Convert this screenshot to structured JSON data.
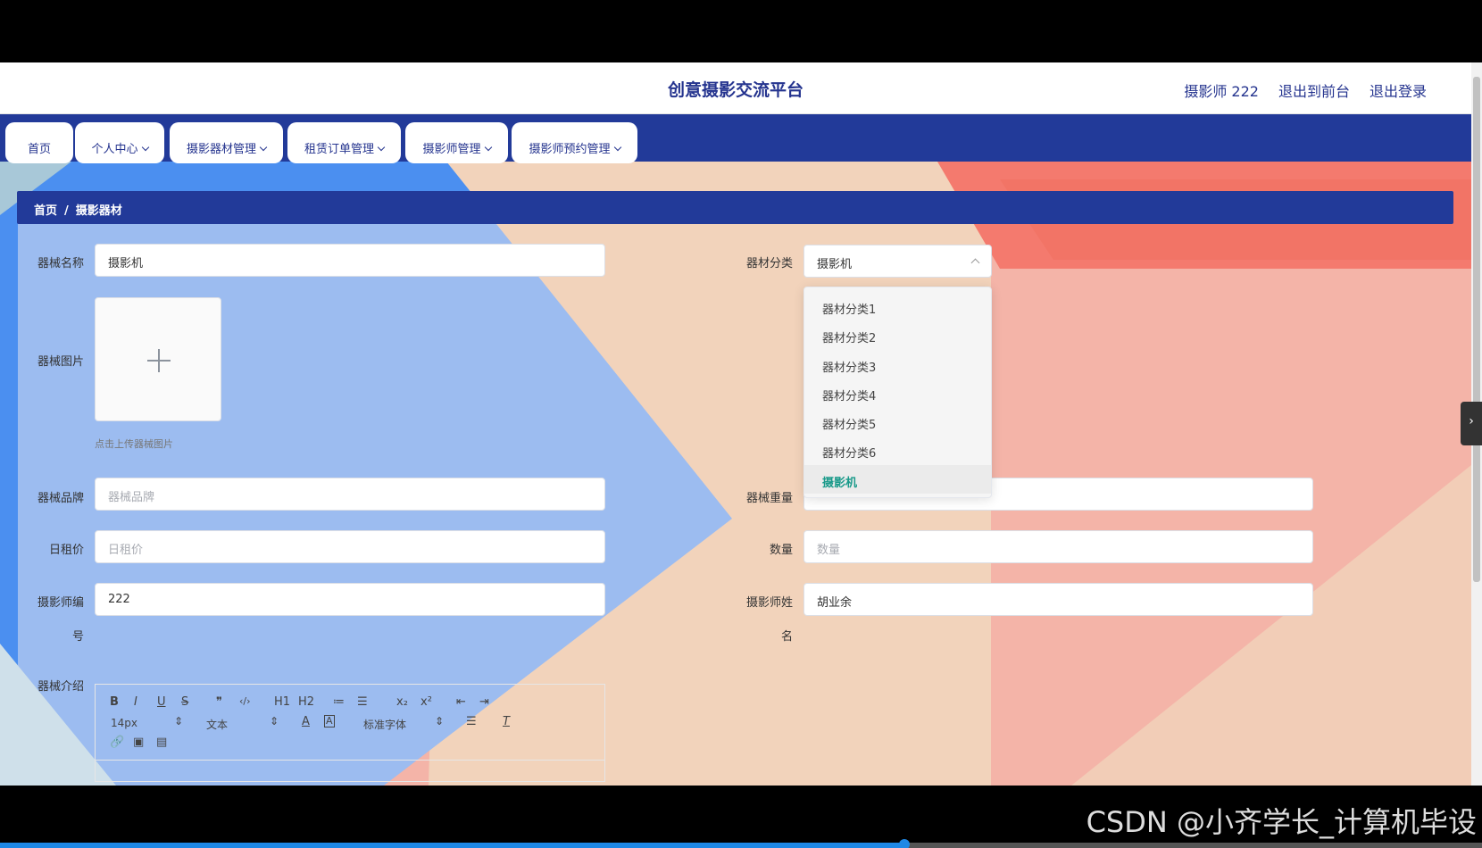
{
  "header": {
    "site_title": "创意摄影交流平台",
    "user": "摄影师 222",
    "exit_front": "退出到前台",
    "logout": "退出登录"
  },
  "nav": [
    {
      "label": "首页",
      "has_dropdown": false
    },
    {
      "label": "个人中心",
      "has_dropdown": true
    },
    {
      "label": "摄影器材管理",
      "has_dropdown": true
    },
    {
      "label": "租赁订单管理",
      "has_dropdown": true
    },
    {
      "label": "摄影师管理",
      "has_dropdown": true
    },
    {
      "label": "摄影师预约管理",
      "has_dropdown": true
    }
  ],
  "breadcrumb": {
    "home": "首页",
    "separator": "/",
    "current": "摄影器材"
  },
  "form": {
    "name_label": "器械名称",
    "name_value": "摄影机",
    "category_label": "器材分类",
    "category_value": "摄影机",
    "image_label": "器械图片",
    "upload_tip": "点击上传器械图片",
    "brand_label": "器械品牌",
    "brand_placeholder": "器械品牌",
    "weight_label": "器械重量",
    "price_label": "日租价",
    "price_placeholder": "日租价",
    "qty_label": "数量",
    "qty_placeholder": "数量",
    "pid_label_1": "摄影师编",
    "pid_label_2": "号",
    "pid_value": "222",
    "pname_label_1": "摄影师姓",
    "pname_label_2": "名",
    "pname_value": "胡业余",
    "intro_label": "器械介绍"
  },
  "dropdown": {
    "options": [
      "器材分类1",
      "器材分类2",
      "器材分类3",
      "器材分类4",
      "器材分类5",
      "器材分类6",
      "摄影机"
    ],
    "selected": "摄影机"
  },
  "editor": {
    "buttons": [
      "B",
      "I",
      "U",
      "S",
      "❞",
      "‹/›",
      "H1",
      "H2",
      "≔",
      "☰",
      "x₂",
      "x²",
      "⇤",
      "⇥"
    ],
    "size_value": "14px",
    "header_value": "文本",
    "font_value": "标准字体"
  },
  "video": {
    "watermark": "CSDN @小齐学长_计算机毕设",
    "progress": 0.61
  },
  "colors": {
    "primary": "#223a99",
    "selected_option": "#1a9a8a"
  }
}
